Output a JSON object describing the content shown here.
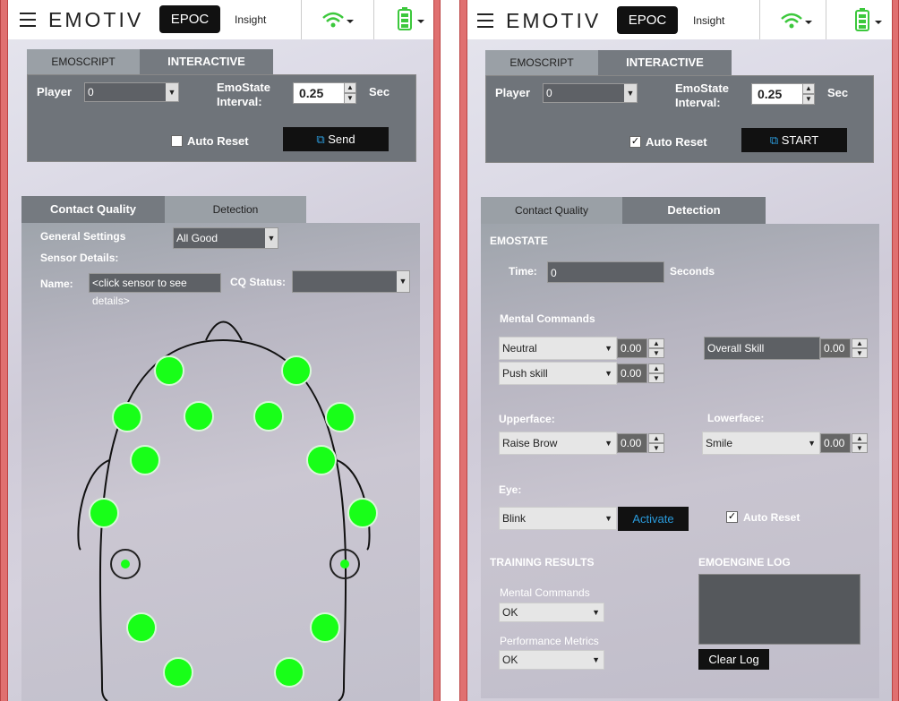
{
  "left": {
    "header": {
      "logo": "EMOTIV",
      "product": "EPOC",
      "app": "Insight"
    },
    "tabs": [
      {
        "label": "EMOSCRIPT"
      },
      {
        "label": "INTERACTIVE"
      }
    ],
    "player": {
      "label": "Player",
      "value": "0"
    },
    "emostate": {
      "label_1": "EmoState",
      "label_2": "Interval:",
      "value": "0.25",
      "unit": "Sec"
    },
    "auto_reset": {
      "label": "Auto Reset",
      "checked": false
    },
    "send_button": "Send",
    "sub_tabs": [
      {
        "label": "Contact Quality"
      },
      {
        "label": "Detection"
      }
    ],
    "general_settings": {
      "label": "General Settings",
      "value": "All Good"
    },
    "sensor_details": "Sensor Details:",
    "name": {
      "label": "Name:",
      "value": "<click sensor to see details>"
    },
    "cq_status": {
      "label": "CQ Status:",
      "value": ""
    }
  },
  "right": {
    "header": {
      "logo": "EMOTIV",
      "product": "EPOC",
      "app": "Insight"
    },
    "tabs": [
      {
        "label": "EMOSCRIPT"
      },
      {
        "label": "INTERACTIVE"
      }
    ],
    "player": {
      "label": "Player",
      "value": "0"
    },
    "emostate": {
      "label_1": "EmoState",
      "label_2": "Interval:",
      "value": "0.25",
      "unit": "Sec"
    },
    "auto_reset": {
      "label": "Auto Reset",
      "checked": true
    },
    "start_button": "START",
    "sub_tabs": [
      {
        "label": "Contact Quality"
      },
      {
        "label": "Detection"
      }
    ],
    "emostate_title": "EMOSTATE",
    "time": {
      "label": "Time:",
      "value": "0",
      "unit": "Seconds"
    },
    "mental_commands": {
      "title": "Mental Commands",
      "rows": [
        {
          "select": "Neutral",
          "value": "0.00"
        },
        {
          "select": "Push skill",
          "value": "0.00"
        }
      ],
      "overall": {
        "label": "Overall Skill",
        "value": "0.00"
      }
    },
    "upperface": {
      "title": "Upperface:",
      "select": "Raise Brow",
      "value": "0.00"
    },
    "lowerface": {
      "title": "Lowerface:",
      "select": "Smile",
      "value": "0.00"
    },
    "eye": {
      "title": "Eye:",
      "select": "Blink",
      "activate": "Activate",
      "auto_reset": "Auto Reset",
      "checked": true
    },
    "training_results": {
      "title": "TRAINING RESULTS",
      "mc_label": "Mental Commands",
      "mc_value": "OK",
      "pm_label": "Performance Metrics",
      "pm_value": "OK"
    },
    "emoengine_log": {
      "title": "EMOENGINE LOG",
      "clear": "Clear Log"
    }
  },
  "colors": {
    "accent": "#18ff18",
    "wifi": "#3cc83c",
    "battery": "#3cc83c",
    "activate_text": "#2a9bdc"
  },
  "icons": [
    "hamburger-icon",
    "wifi-icon",
    "battery-icon",
    "chevron-down-icon",
    "external-link-icon",
    "checkbox-icon"
  ]
}
